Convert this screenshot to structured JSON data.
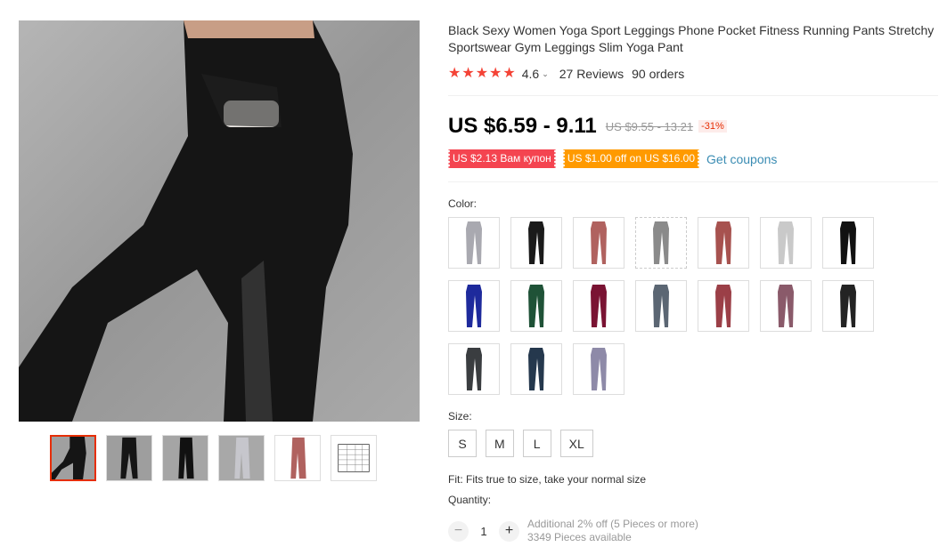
{
  "product": {
    "title": "Black Sexy Women Yoga Sport Leggings Phone Pocket Fitness Running Pants Stretchy Sportswear Gym Leggings Slim Yoga Pant",
    "rating": "4.6",
    "reviews": "27 Reviews",
    "orders": "90 orders",
    "price": "US $6.59 - 9.11",
    "old_price": "US $9.55 - 13.21",
    "discount": "-31%"
  },
  "coupons": {
    "coupon1": "US $2.13 Вам купон",
    "coupon2": "US $1.00 off on US $16.00",
    "get_coupons": "Get coupons"
  },
  "color": {
    "label": "Color:",
    "swatches": [
      {
        "color": "#a9a9b0"
      },
      {
        "color": "#1a1a1a"
      },
      {
        "color": "#b0625f"
      },
      {
        "color": "#8a8a8a"
      },
      {
        "color": "#a7524f"
      },
      {
        "color": "#c9c9c9"
      },
      {
        "color": "#111111"
      },
      {
        "color": "#1e2a9c"
      },
      {
        "color": "#1f5237"
      },
      {
        "color": "#7a1333"
      },
      {
        "color": "#5b6673"
      },
      {
        "color": "#9b3f47"
      },
      {
        "color": "#8a5a6a"
      },
      {
        "color": "#232323"
      },
      {
        "color": "#3a3d40"
      },
      {
        "color": "#25384d"
      },
      {
        "color": "#8e8aa8"
      }
    ]
  },
  "size": {
    "label": "Size:",
    "options": [
      "S",
      "M",
      "L",
      "XL"
    ]
  },
  "fit": "Fit: Fits true to size, take your normal size",
  "quantity": {
    "label": "Quantity:",
    "minus": "−",
    "value": "1",
    "plus": "+",
    "additional": "Additional 2% off (5 Pieces or more)",
    "available": "3349 Pieces available"
  },
  "icons": {
    "star": "★",
    "chevron": "⌄"
  },
  "colors": {
    "accent": "#e62e04",
    "star": "#f44336",
    "coupon_red": "#f44450",
    "coupon_orange": "#ff9a00",
    "link": "#3a8cb3"
  }
}
